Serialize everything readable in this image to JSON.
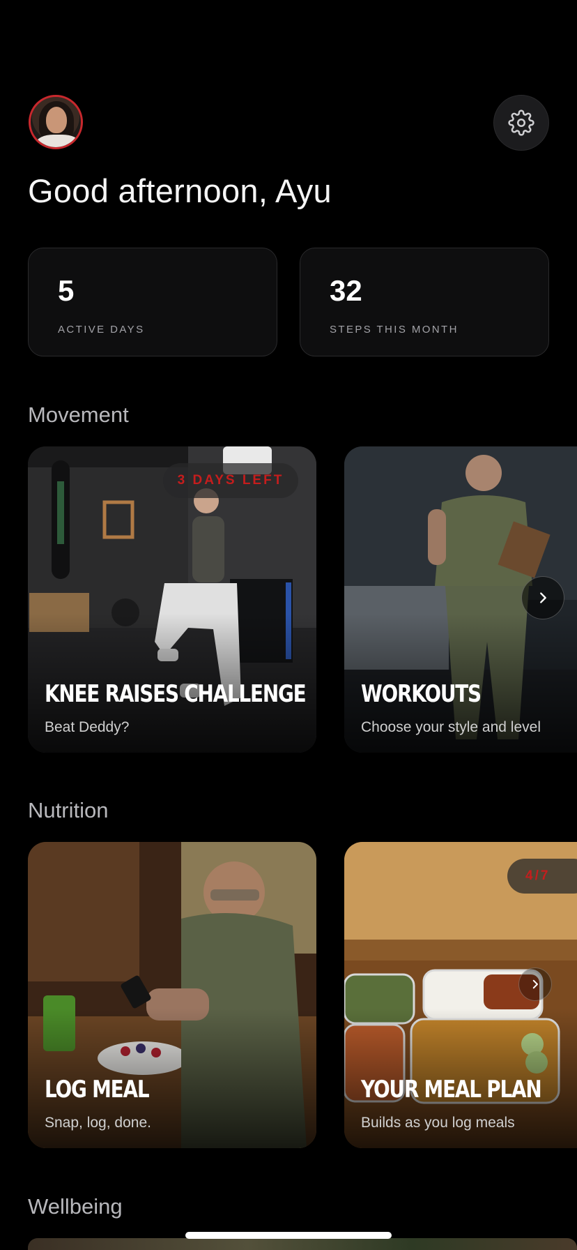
{
  "header": {
    "avatar_icon": "user-avatar",
    "settings_icon": "gear-icon",
    "greeting": "Good afternoon, Ayu"
  },
  "stats": [
    {
      "value": "5",
      "label": "ACTIVE DAYS"
    },
    {
      "value": "32",
      "label": "STEPS THIS MONTH"
    }
  ],
  "movement": {
    "title": "Movement",
    "cards": [
      {
        "title": "KNEE RAISES CHALLENGE",
        "subtitle": "Beat Deddy?",
        "badge": "3 DAYS LEFT"
      },
      {
        "title": "WORKOUTS",
        "subtitle": "Choose your style and level"
      }
    ]
  },
  "nutrition": {
    "title": "Nutrition",
    "cards": [
      {
        "title": "LOG MEAL",
        "subtitle": "Snap, log, done."
      },
      {
        "title": "YOUR MEAL PLAN",
        "subtitle": "Builds as you log meals",
        "badge": "4/7"
      }
    ]
  },
  "wellbeing": {
    "title": "Wellbeing"
  },
  "colors": {
    "accent_red": "#c51d1d",
    "card_bg": "#0e0e0f",
    "avatar_ring": "#c8282d"
  }
}
